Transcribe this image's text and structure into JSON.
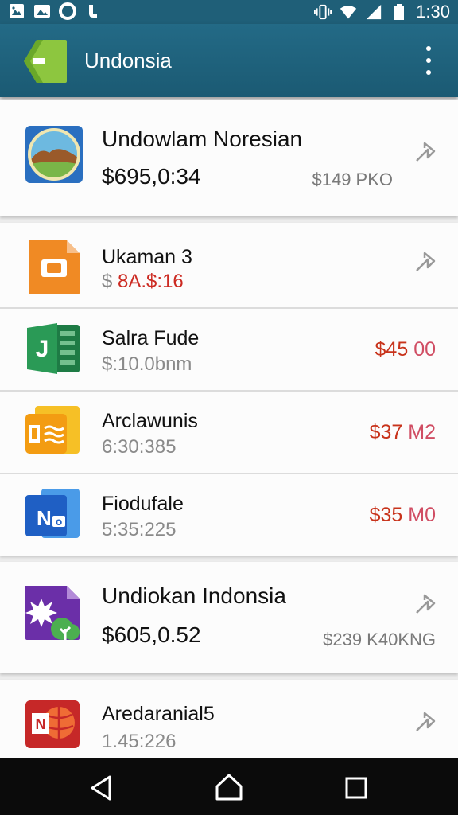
{
  "status_bar": {
    "time": "1:30",
    "left_icons": [
      "photo-frame-icon",
      "image-icon",
      "circle-app-icon",
      "share-app-icon"
    ],
    "right_icons": [
      "vibrate-icon",
      "wifi-icon",
      "signal-icon",
      "battery-icon"
    ]
  },
  "app_bar": {
    "title": "Undonsia",
    "overflow_icon": "more-vertical-icon",
    "accent": "#1f6580"
  },
  "items": [
    {
      "icon": "landscape-photo-icon",
      "title": "Undowlam Noresian",
      "amount": "$695,0:34",
      "side_text": "$149 PKO",
      "chevron": true
    },
    {
      "icon": "slides-app-icon",
      "title": "Ukaman 3",
      "amount_prefix": "$",
      "amount": "8A.$:16",
      "chevron": true
    },
    {
      "icon": "spreadsheet-app-icon",
      "title": "Salra Fude",
      "amount": "$:10.0bnm",
      "side_main": "$45",
      "side_suffix": "00"
    },
    {
      "icon": "keep-notes-app-icon",
      "title": "Arclawunis",
      "amount": "6:30:385",
      "side_main": "$37",
      "side_suffix": "M2"
    },
    {
      "icon": "notes-app-icon",
      "title": "Fiodufale",
      "amount": "5:35:225",
      "side_main": "$35",
      "side_suffix": "M0"
    },
    {
      "icon": "nature-app-icon",
      "title": "Undiokan Indonsia",
      "amount": "$605,0.52",
      "side_text": "$239 K40KNG",
      "chevron": true
    },
    {
      "icon": "red-app-icon",
      "title": "Aredaranial5",
      "amount": "1.45:226",
      "chevron": true
    }
  ],
  "nav": {
    "back": "back-icon",
    "home": "home-icon",
    "recents": "recents-icon"
  }
}
